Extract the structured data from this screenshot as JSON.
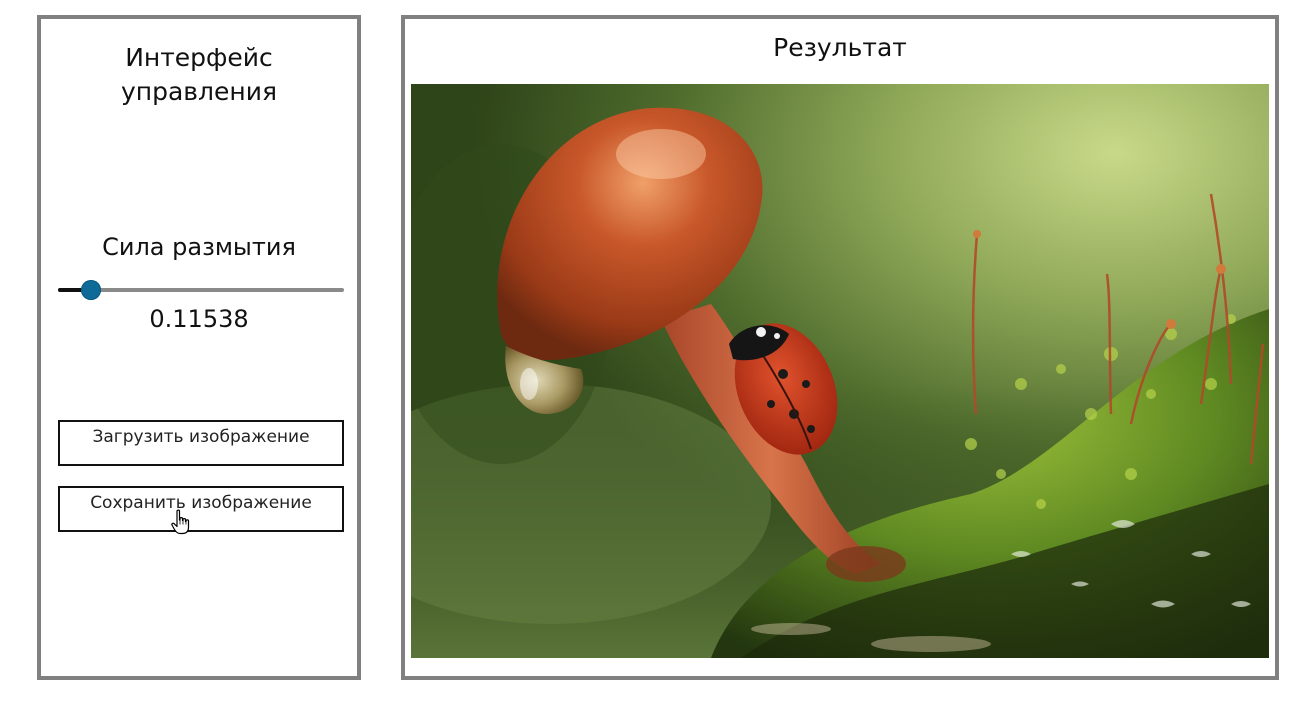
{
  "control_panel": {
    "title": "Интерфейс управления",
    "blur": {
      "label": "Сила размытия",
      "value": 0.11538,
      "value_text": "0.11538",
      "accent": "#0e6a97"
    },
    "buttons": {
      "load_label": "Загрузить изображение",
      "save_label": "Сохранить изображение"
    }
  },
  "result_panel": {
    "title": "Результат",
    "image": {
      "subject": "mushroom-with-ladybug-photo"
    }
  },
  "colors": {
    "panel_border": "#808080",
    "button_border": "#111111",
    "slider_track": "#8a8a8a",
    "slider_thumb": "#0e6a97"
  }
}
